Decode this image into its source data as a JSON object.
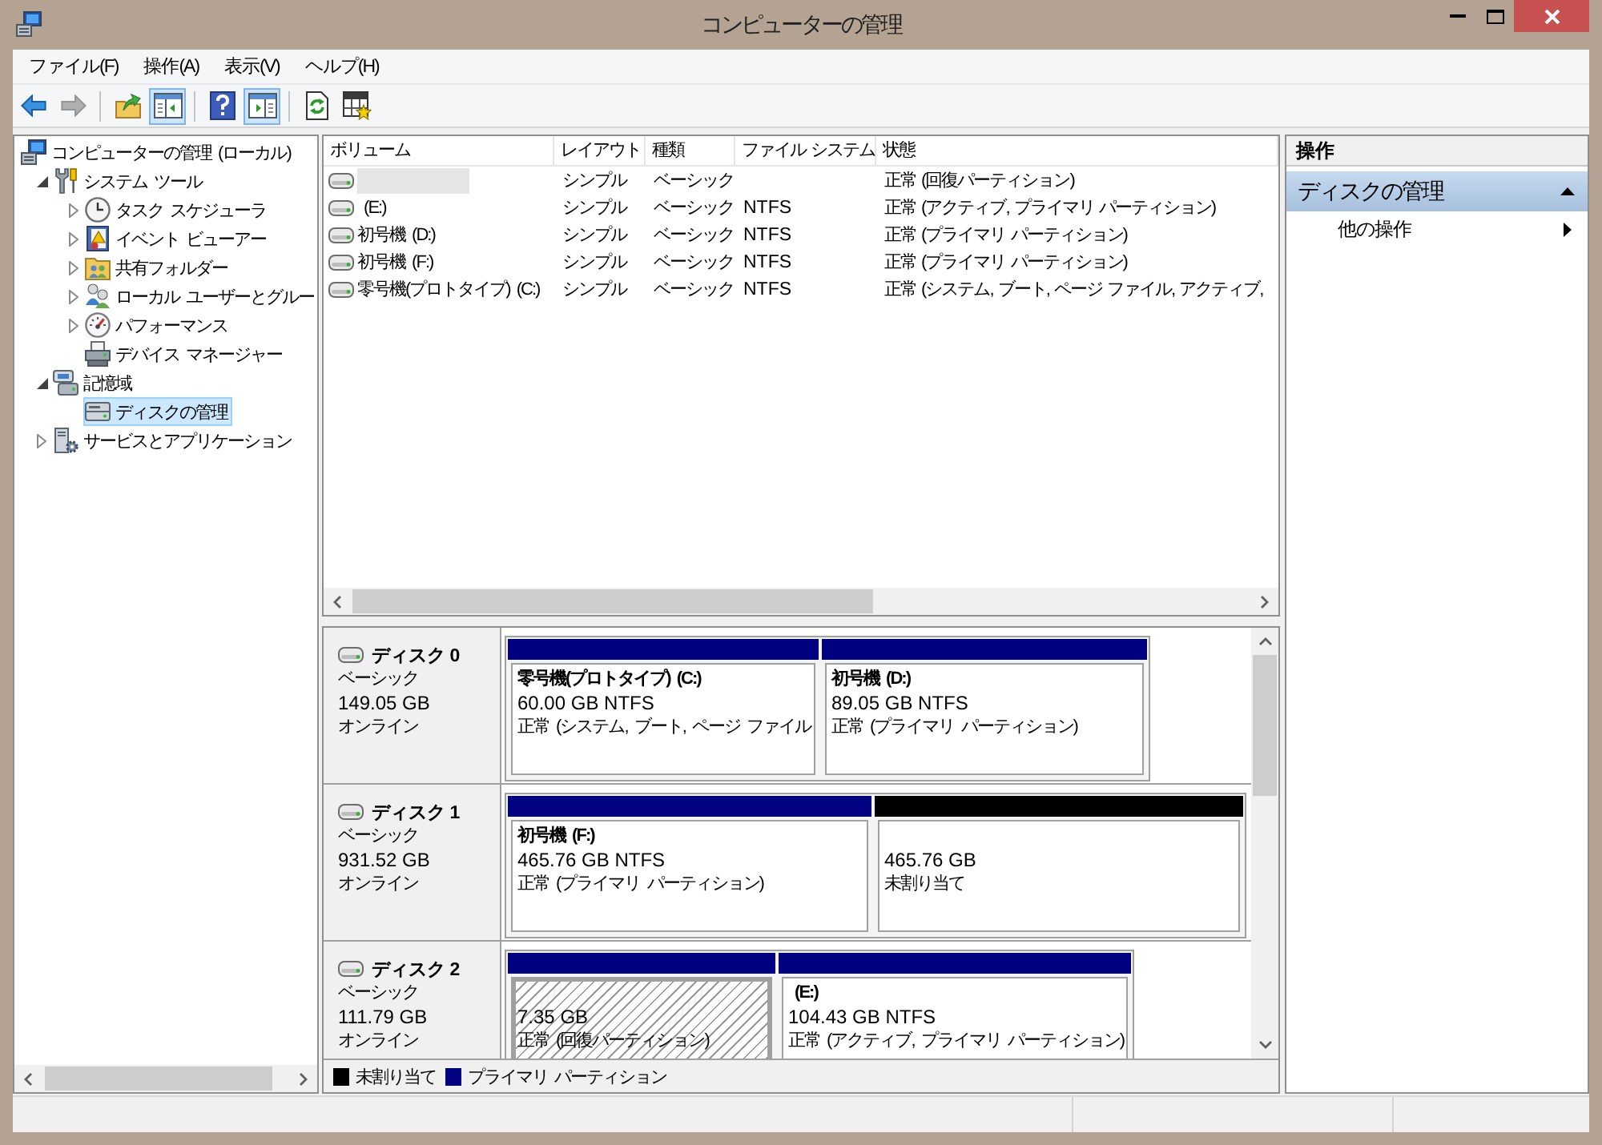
{
  "window": {
    "title": "コンピューターの管理"
  },
  "menu": [
    "ファイル(F)",
    "操作(A)",
    "表示(V)",
    "ヘルプ(H)"
  ],
  "toolbar": [
    {
      "kind": "button",
      "disabled": false,
      "pressed": false
    },
    {
      "kind": "button",
      "disabled": true,
      "pressed": false
    },
    {
      "kind": "separator"
    },
    {
      "kind": "button",
      "disabled": false,
      "pressed": false
    },
    {
      "kind": "button",
      "disabled": false,
      "pressed": true
    },
    {
      "kind": "separator"
    },
    {
      "kind": "button",
      "disabled": false,
      "pressed": false
    },
    {
      "kind": "button",
      "disabled": false,
      "pressed": true
    },
    {
      "kind": "separator"
    },
    {
      "kind": "button",
      "disabled": false,
      "pressed": false
    },
    {
      "kind": "button",
      "disabled": false,
      "pressed": false
    }
  ],
  "tree": [
    {
      "label": "コンピューターの管理 (ローカル)",
      "selected": false,
      "children": [
        {
          "label": "システム ツール",
          "expanded": true,
          "selected": false,
          "children": [
            {
              "label": "タスク スケジューラ",
              "expanded": false,
              "selected": false
            },
            {
              "label": "イベント ビューアー",
              "expanded": false,
              "selected": false
            },
            {
              "label": "共有フォルダー",
              "expanded": false,
              "selected": false
            },
            {
              "label": "ローカル ユーザーとグルー",
              "expanded": false,
              "selected": false
            },
            {
              "label": "パフォーマンス",
              "expanded": false,
              "selected": false
            },
            {
              "label": "デバイス マネージャー",
              "selected": false
            }
          ]
        },
        {
          "label": "記憶域",
          "expanded": true,
          "selected": false,
          "children": [
            {
              "label": "ディスクの管理",
              "selected": true
            }
          ]
        },
        {
          "label": "サービスとアプリケーション",
          "expanded": false,
          "selected": false
        }
      ]
    }
  ],
  "volumes": {
    "columns": [
      "ボリューム",
      "レイアウト",
      "種類",
      "ファイル システム",
      "状態"
    ],
    "rows": [
      {
        "selected": true,
        "layout": "シンプル",
        "type": "ベーシック",
        "status": "正常 (回復パーティション)"
      },
      {
        "volume": " (E:)",
        "selected": false,
        "layout": "シンプル",
        "type": "ベーシック",
        "file_system": "NTFS",
        "status": "正常 (アクティブ, プライマリ パーティション)"
      },
      {
        "volume": "初号機 (D:)",
        "selected": false,
        "layout": "シンプル",
        "type": "ベーシック",
        "file_system": "NTFS",
        "status": "正常 (プライマリ パーティション)"
      },
      {
        "volume": "初号機 (F:)",
        "selected": false,
        "layout": "シンプル",
        "type": "ベーシック",
        "file_system": "NTFS",
        "status": "正常 (プライマリ パーティション)"
      },
      {
        "volume": "零号機(プロトタイプ) (C:)",
        "selected": false,
        "layout": "シンプル",
        "type": "ベーシック",
        "file_system": "NTFS",
        "status": "正常 (システム, ブート, ページ ファイル, アクティブ,"
      }
    ]
  },
  "disks": [
    {
      "name": "ディスク 0",
      "type": "ベーシック",
      "size": "149.05 GB",
      "state": "オンライン",
      "partitions": [
        {
          "label": "零号機(プロトタイプ) (C:)",
          "size": "60.00 GB NTFS",
          "status": "正常 (システム, ブート, ページ ファイル",
          "color": "#000080",
          "selected": false
        },
        {
          "label": "初号機 (D:)",
          "size": "89.05 GB NTFS",
          "status": "正常 (プライマリ パーティション)",
          "color": "#000080",
          "selected": false
        }
      ]
    },
    {
      "name": "ディスク 1",
      "type": "ベーシック",
      "size": "931.52 GB",
      "state": "オンライン",
      "partitions": [
        {
          "label": "初号機 (F:)",
          "size": "465.76 GB NTFS",
          "status": "正常 (プライマリ パーティション)",
          "color": "#000080",
          "selected": false
        },
        {
          "size": "465.76 GB",
          "status": "未割り当て",
          "color": "#000000",
          "selected": false
        }
      ]
    },
    {
      "name": "ディスク 2",
      "type": "ベーシック",
      "size": "111.79 GB",
      "state": "オンライン",
      "partitions": [
        {
          "size": "7.35 GB",
          "status": "正常 (回復パーティション)",
          "color": "#000080",
          "selected": true
        },
        {
          "label": " (E:)",
          "size": "104.43 GB NTFS",
          "status": "正常 (アクティブ, プライマリ パーティション)",
          "color": "#000080",
          "selected": false
        }
      ]
    }
  ],
  "legend": [
    {
      "label": "未割り当て",
      "color": "#000000"
    },
    {
      "label": "プライマリ パーティション",
      "color": "#000080"
    }
  ],
  "actions": {
    "title": "操作",
    "sections": [
      {
        "title": "ディスクの管理",
        "expanded": true,
        "items": [
          {
            "label": "他の操作",
            "kind": "submenu"
          }
        ]
      }
    ]
  }
}
